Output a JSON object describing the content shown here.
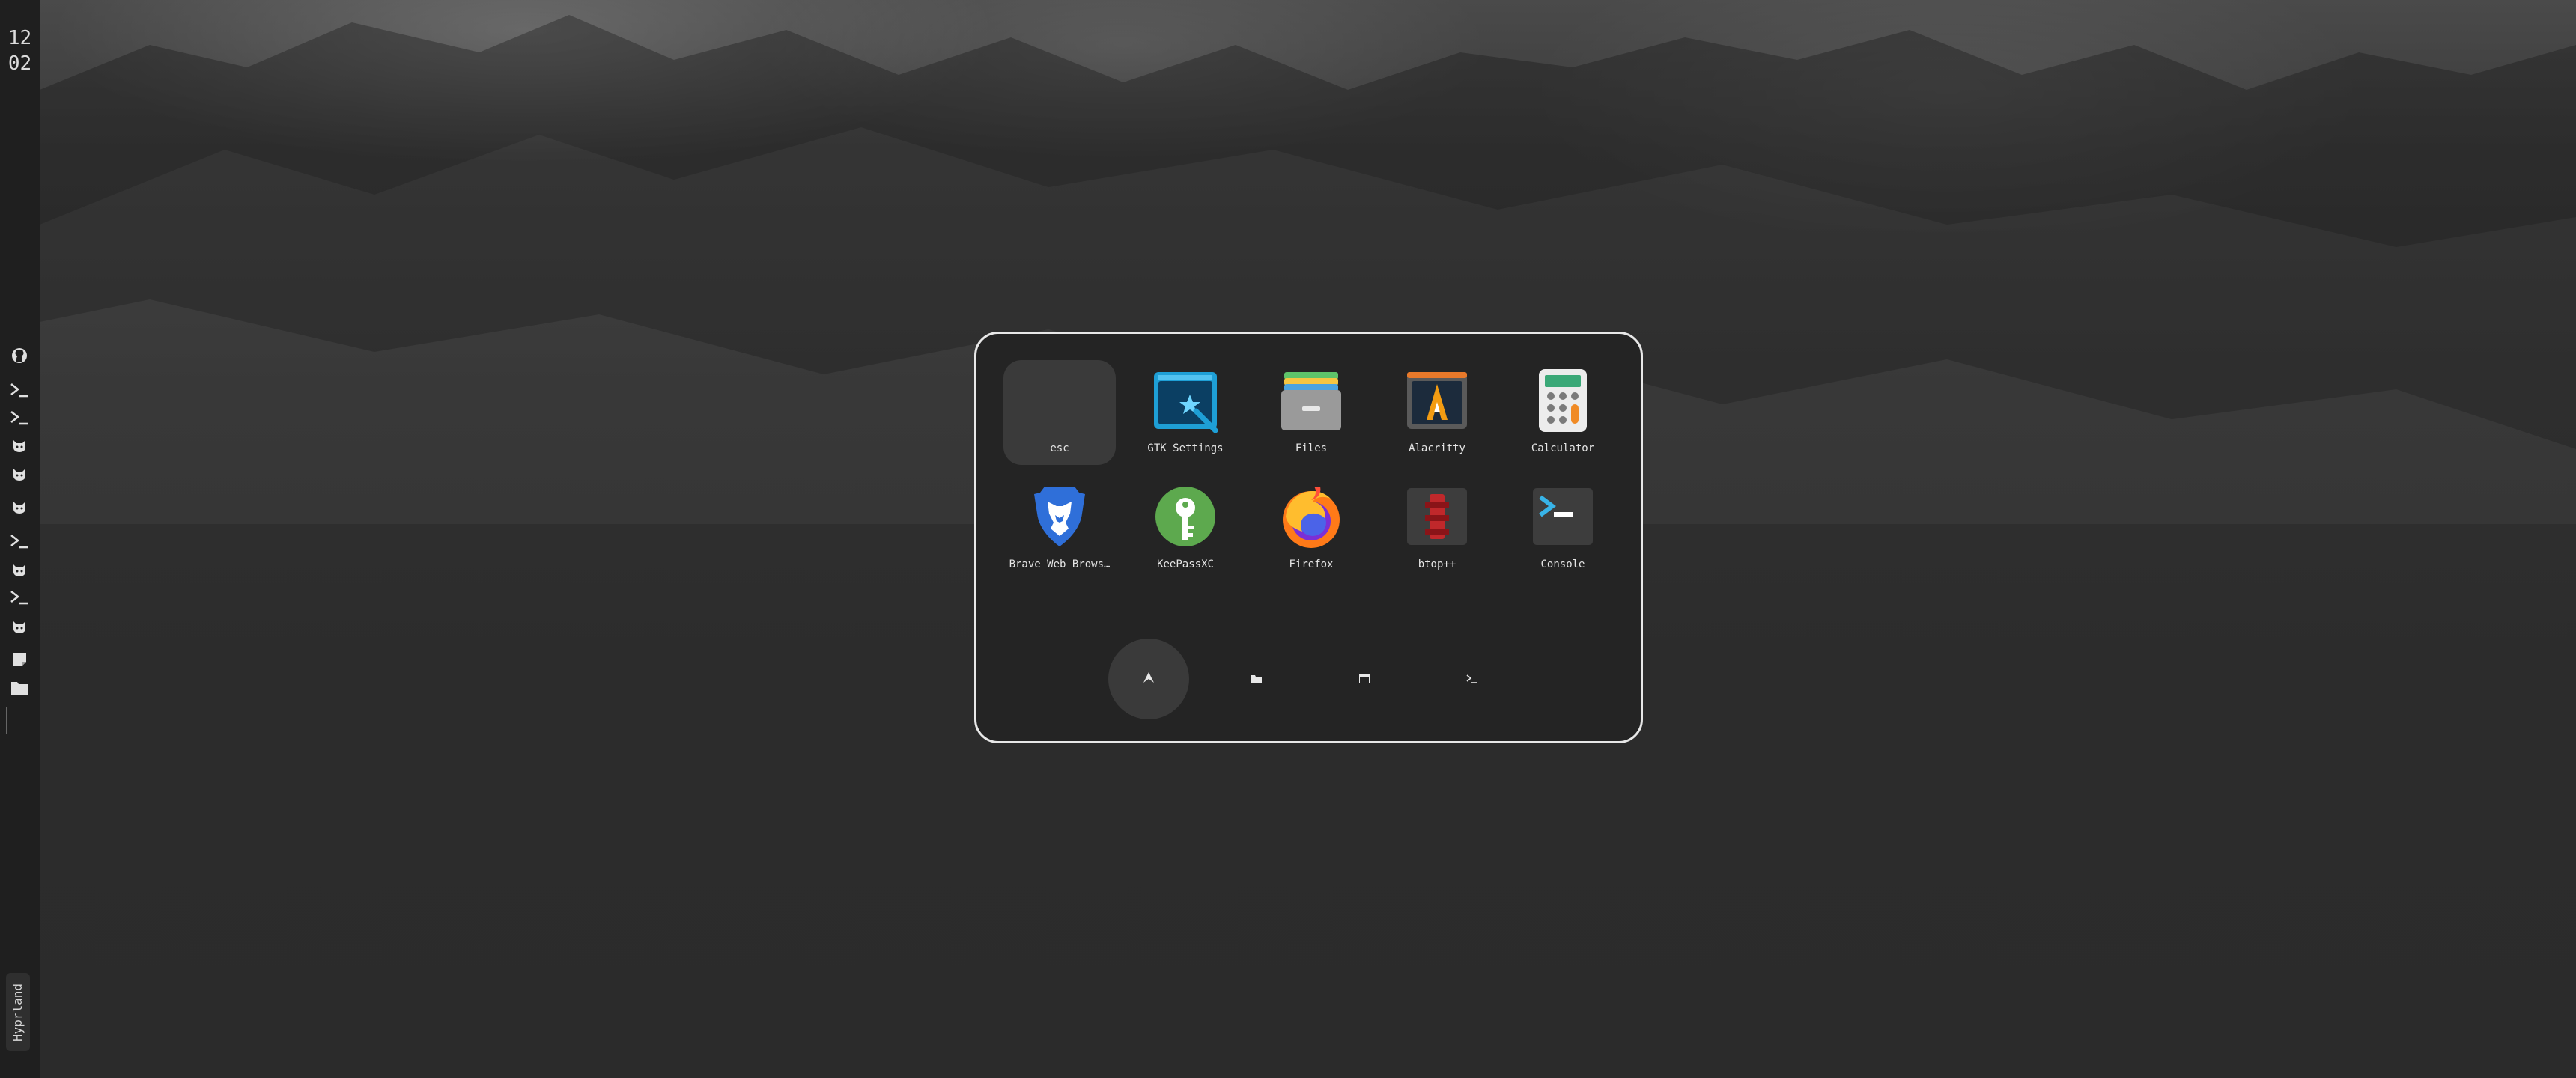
{
  "clock": {
    "hour": "12",
    "minute": "02"
  },
  "workspace": {
    "label": "Hyprland"
  },
  "bar_icons": [
    "github-icon",
    "terminal-icon",
    "terminal-icon",
    "cat-icon",
    "cat-icon",
    "cat-icon",
    "terminal-icon",
    "cat-icon",
    "terminal-icon",
    "cat-icon",
    "note-icon",
    "folder-icon"
  ],
  "launcher": {
    "apps": [
      {
        "label": "esc",
        "icon": "blank-icon",
        "selected": true
      },
      {
        "label": "GTK Settings",
        "icon": "gtk-settings-icon"
      },
      {
        "label": "Files",
        "icon": "files-icon"
      },
      {
        "label": "Alacritty",
        "icon": "alacritty-icon"
      },
      {
        "label": "Calculator",
        "icon": "calculator-icon"
      },
      {
        "label": "Brave Web Brows…",
        "icon": "brave-icon"
      },
      {
        "label": "KeePassXC",
        "icon": "keepassxc-icon"
      },
      {
        "label": "Firefox",
        "icon": "firefox-icon"
      },
      {
        "label": "btop++",
        "icon": "btop-icon"
      },
      {
        "label": "Console",
        "icon": "console-icon"
      }
    ],
    "modes": [
      {
        "name": "apps",
        "icon": "arch-icon",
        "active": true
      },
      {
        "name": "files",
        "icon": "folder-icon"
      },
      {
        "name": "windows",
        "icon": "window-icon"
      },
      {
        "name": "run",
        "icon": "terminal-icon"
      }
    ]
  },
  "colors": {
    "accent": "#e8e8e8",
    "bar_bg": "#1f1f1f",
    "launcher_bg": "#242424",
    "selected_bg": "#3a3a3a"
  }
}
